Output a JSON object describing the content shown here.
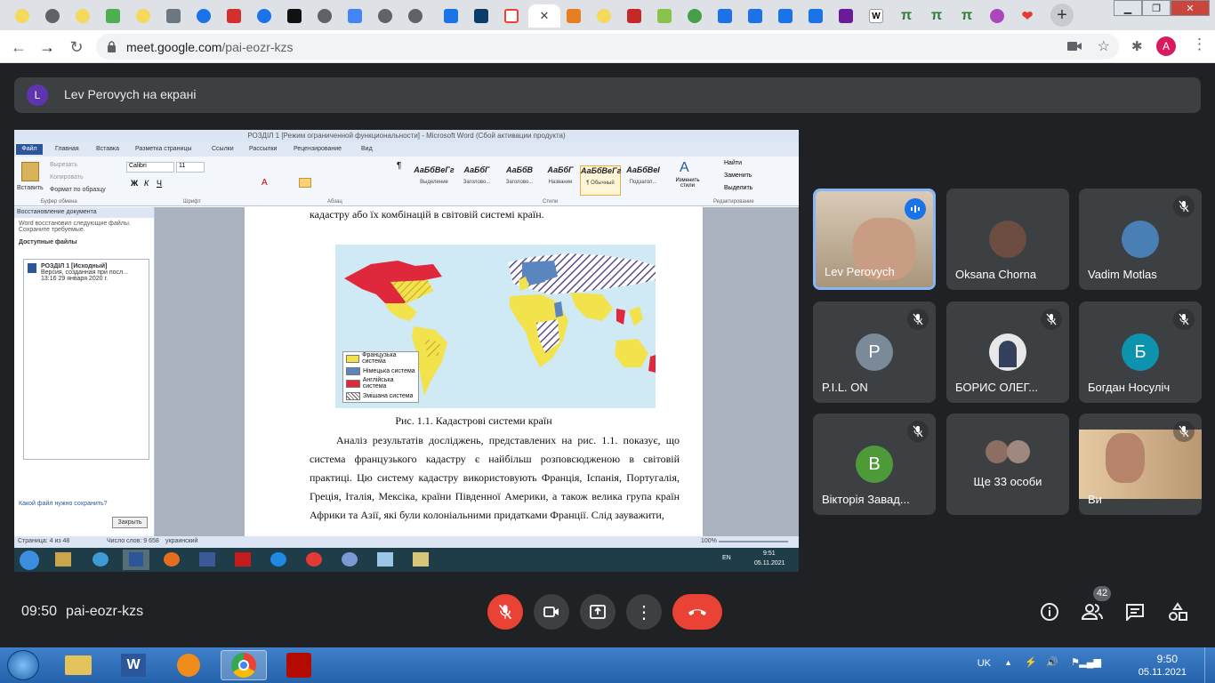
{
  "browser": {
    "url_host": "meet.google.com",
    "url_path": "/pai-eozr-kzs",
    "profile_initial": "A"
  },
  "presentation": {
    "presenter_initial": "L",
    "banner": "Lev Perovych на екрані"
  },
  "word": {
    "title": "РОЗДІЛ 1 [Режим ограниченной функциональности] - Microsoft Word (Сбой активации продукта)",
    "tabs": [
      "Файл",
      "Главная",
      "Вставка",
      "Разметка страницы",
      "Ссылки",
      "Рассылки",
      "Рецензирование",
      "Вид"
    ],
    "font_name": "Calibri",
    "font_size": "11",
    "clipboard": [
      "Вырезать",
      "Копировать",
      "Формат по образцу"
    ],
    "paste": "Вставить",
    "groups": [
      "Буфер обмена",
      "Шрифт",
      "Абзац",
      "Стили",
      "Редактирование"
    ],
    "styles": [
      {
        "sample": "АаБбВеГг",
        "name": "Выделение"
      },
      {
        "sample": "АаБбГ",
        "name": "Заголово..."
      },
      {
        "sample": "АаБбВ",
        "name": "Заголово..."
      },
      {
        "sample": "АаБбГ",
        "name": "Название"
      },
      {
        "sample": "АаБбВеГг",
        "name": "¶ Обычный"
      },
      {
        "sample": "АаБбВеI",
        "name": "Подзагол..."
      }
    ],
    "change_styles": "Изменить стили",
    "editing": [
      "Найти",
      "Заменить",
      "Выделить"
    ],
    "recovery": {
      "header": "Восстановление документа",
      "message": "Word восстановил следующие файлы. Сохраните требуемые.",
      "available": "Доступные файлы",
      "file_name": "РОЗДІЛ 1 [Исходный]",
      "file_desc": "Версия, созданная при посл...",
      "file_date": "13:16 29 января 2020 г.",
      "question": "Какой файл нужно сохранить?",
      "close": "Закрыть"
    },
    "doc": {
      "line_top": "кадастру або їх комбінацій в світовій системі країн.",
      "caption": "Рис. 1.1. Кадастрові системи країн",
      "paragraph": "Аналіз результатів досліджень, представлених на рис. 1.1. показує, що система французького кадастру є найбільш розповсюдженою в світовій практиці. Цю систему кадастру використовують Франція, Іспанія, Португалія, Греція, Італія, Мексіка, країни Південної Америки, а також велика група країн Африки та Азії, які були колоніальними придатками Франції. Слід зауважити,",
      "legend": [
        "Французька система",
        "Німецька система",
        "Англійська система",
        "Змішана система"
      ],
      "legend_colors": [
        "#f2e24c",
        "#5a86c0",
        "#e0283c",
        "#ffffff"
      ]
    },
    "status": {
      "page": "Страница: 4 из 48",
      "words": "Число слов: 9 658",
      "lang": "украинский",
      "zoom": "100%"
    },
    "taskbar_time": "9:51",
    "taskbar_date": "05.11.2021",
    "taskbar_lang": "EN"
  },
  "participants": [
    {
      "name": "Lev Perovych",
      "type": "video",
      "speaking": true
    },
    {
      "name": "Oksana Chorna",
      "type": "photo",
      "muted": false
    },
    {
      "name": "Vadim Motlas",
      "type": "photo",
      "muted": true
    },
    {
      "name": "P.I.L. ON",
      "type": "initial",
      "initial": "P",
      "color": "#7b8a98",
      "muted": true
    },
    {
      "name": "БОРИС ОЛЕГ...",
      "type": "photo",
      "muted": true
    },
    {
      "name": "Богдан Носуліч",
      "type": "initial",
      "initial": "Б",
      "color": "#0e93ae",
      "muted": true
    },
    {
      "name": "Вікторія Завад...",
      "type": "initial",
      "initial": "В",
      "color": "#4e9a39",
      "muted": true
    },
    {
      "name": "Ще 33 особи",
      "type": "group"
    },
    {
      "name": "Ви",
      "type": "video",
      "muted": true
    }
  ],
  "controls": {
    "time": "09:50",
    "meeting_code": "pai-eozr-kzs",
    "participant_count": "42"
  },
  "os_taskbar": {
    "lang": "UK",
    "time": "9:50",
    "date": "05.11.2021"
  }
}
